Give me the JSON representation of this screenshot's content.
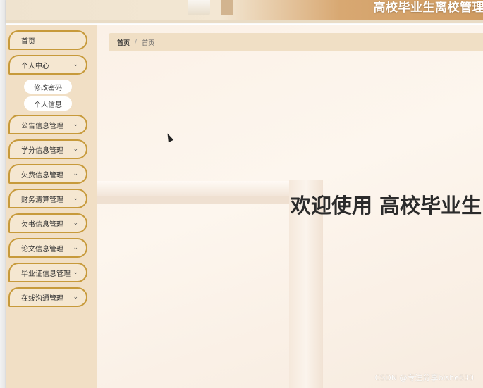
{
  "header": {
    "title": "高校毕业生离校管理"
  },
  "sidebar": {
    "items": [
      {
        "label": "首页",
        "has_arrow": false
      },
      {
        "label": "个人中心",
        "has_arrow": true
      },
      {
        "label": "公告信息管理",
        "has_arrow": true
      },
      {
        "label": "学分信息管理",
        "has_arrow": true
      },
      {
        "label": "欠费信息管理",
        "has_arrow": true
      },
      {
        "label": "财务清算管理",
        "has_arrow": true
      },
      {
        "label": "欠书信息管理",
        "has_arrow": true
      },
      {
        "label": "论文信息管理",
        "has_arrow": true
      },
      {
        "label": "毕业证信息管理",
        "has_arrow": true
      },
      {
        "label": "在线沟通管理",
        "has_arrow": true
      }
    ],
    "submenu": [
      {
        "label": "修改密码"
      },
      {
        "label": "个人信息"
      }
    ],
    "arrow_glyph": "⌄"
  },
  "breadcrumb": {
    "home": "首页",
    "separator": "/",
    "current": "首页"
  },
  "main": {
    "welcome": "欢迎使用 高校毕业生"
  },
  "watermark": "CSDN @专注分享bishe530",
  "colors": {
    "sidebar_bg": "#f1dfc5",
    "menu_border": "#c79a3b",
    "accent": "#cf9b61"
  }
}
